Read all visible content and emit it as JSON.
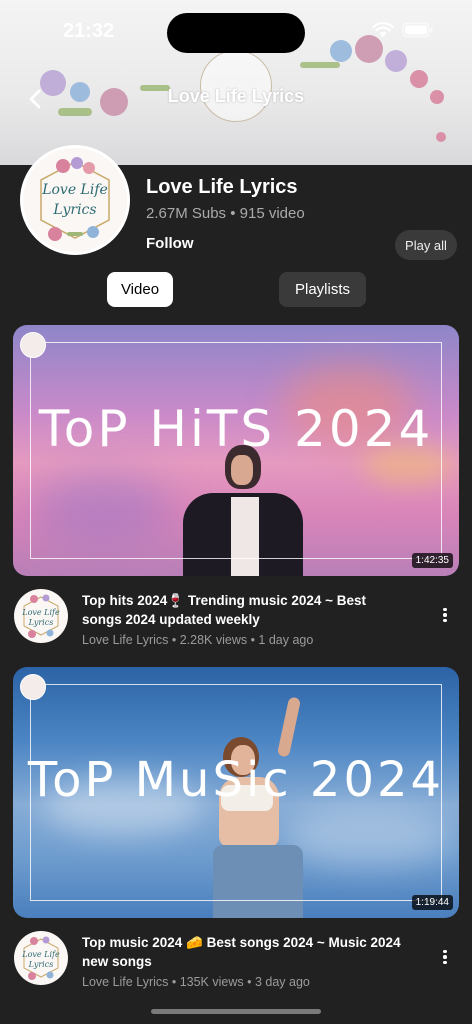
{
  "status": {
    "time": "21:32"
  },
  "header": {
    "title": "Love Life Lyrics",
    "back_icon": "chevron-left-icon"
  },
  "channel": {
    "logo_line1": "Love Life",
    "logo_line2": "Lyrics",
    "name": "Love Life Lyrics",
    "meta": "2.67M Subs • 915 video",
    "follow_label": "Follow",
    "play_all_label": "Play all"
  },
  "tabs": [
    {
      "label": "Video",
      "active": true
    },
    {
      "label": "Playlists",
      "active": false
    }
  ],
  "videos": [
    {
      "thumb_text": "ToP HiTS 2024",
      "duration": "1:42:35",
      "title": "Top hits 2024🍷 Trending music 2024 ~ Best songs 2024 updated weekly",
      "meta": "Love Life Lyrics • 2.28K views • 1 day ago"
    },
    {
      "thumb_text": "ToP MuSic 2024",
      "duration": "1:19:44",
      "title": "Top music 2024 🧀 Best songs 2024 ~ Music 2024 new songs",
      "meta": "Love Life Lyrics • 135K views • 3 day ago"
    }
  ],
  "colors": {
    "background": "#212121",
    "accent_white": "#ffffff",
    "chip": "#3a3a3a"
  }
}
